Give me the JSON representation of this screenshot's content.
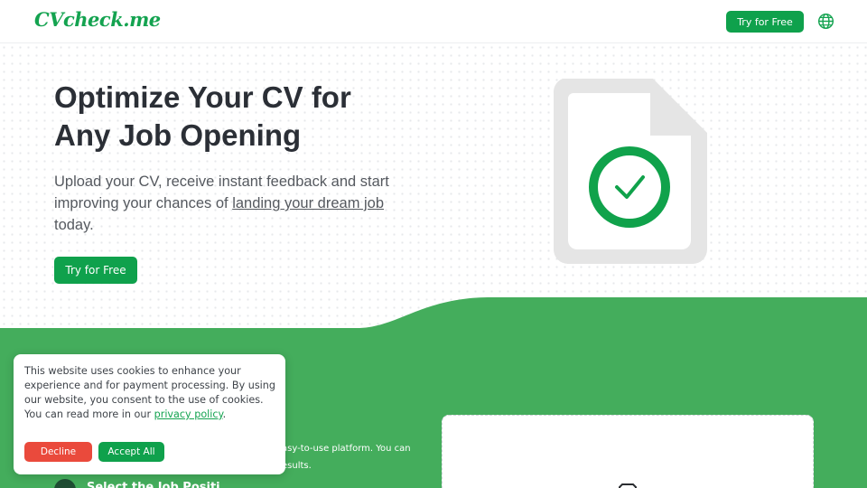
{
  "header": {
    "logo": "CVcheck.me",
    "cta_label": "Try for Free",
    "language_icon": "globe-icon"
  },
  "hero": {
    "title_line1": "Optimize Your CV for",
    "title_line2": "Any Job Opening",
    "subtitle_part1": "Upload your CV, receive instant feedback and start improving your chances of ",
    "subtitle_link": "landing your dream job",
    "subtitle_part2": " today.",
    "cta_label": "Try for Free",
    "illustration_icon": "document-check-icon"
  },
  "green_section": {
    "text_partial": "asy-to-use platform. You can esults.",
    "step_label": "Select the Job Positi",
    "card_icon": "upload-icon"
  },
  "cookie_banner": {
    "text": "This website uses cookies to enhance your experience and for payment processing. By using our website, you consent to the use of cookies. You can read more in our ",
    "link": "privacy policy",
    "text_end": ".",
    "decline_label": "Decline",
    "accept_label": "Accept All"
  },
  "colors": {
    "brand_green": "#0fa14c",
    "section_green": "#44ad5c",
    "decline_red": "#ea4a3c"
  }
}
